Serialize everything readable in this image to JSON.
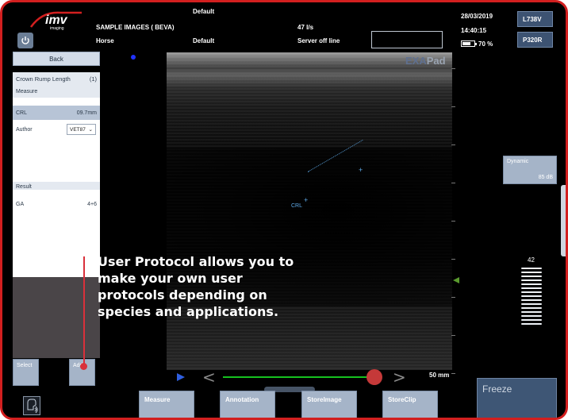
{
  "header": {
    "logo_text": "imv",
    "logo_sub": "imaging",
    "preset": "Default",
    "patient_id": "SAMPLE IMAGES ( BEVA)",
    "species": "Horse",
    "mode_preset": "Default",
    "frame_rate": "47 I/s",
    "server_status": "Server off line",
    "date": "28/03/2019",
    "time": "14:40:15",
    "battery": "70 %",
    "battery_level": 0.7,
    "probe_1": "L738V",
    "probe_2": "P320R"
  },
  "left_panel": {
    "back_label": "Back",
    "protocol_name": "Crown Rump Length",
    "protocol_count": "(1)",
    "measure_heading": "Measure",
    "crl_label": "CRL",
    "crl_value": "09.7mm",
    "author_label": "Author",
    "author_value": "VET87",
    "result_heading": "Result",
    "ga_label": "GA",
    "ga_value": "4+6",
    "select_label": "Select",
    "add_label": "Add"
  },
  "image": {
    "brand": "EXA",
    "brand_suffix": "Pad",
    "crl_marker": "CRL",
    "depth": "50 mm"
  },
  "right_panel": {
    "dynamic_label": "Dynamic",
    "dynamic_value": "85 dB",
    "gain_value": "42"
  },
  "bottom_bar": {
    "measure": "Measure",
    "annotation": "Annotation",
    "store_image": "StoreImage",
    "store_clip": "StoreClip",
    "freeze": "Freeze"
  },
  "callout": {
    "text": "User Protocol allows you to make your own user protocols depending on species and applications."
  },
  "colors": {
    "frame_border": "#d21f1f",
    "button_blue": "#a5b4c8",
    "freeze_blue": "#3e5675",
    "timeline_green": "#16c11f",
    "callout_red": "#d9303b"
  }
}
